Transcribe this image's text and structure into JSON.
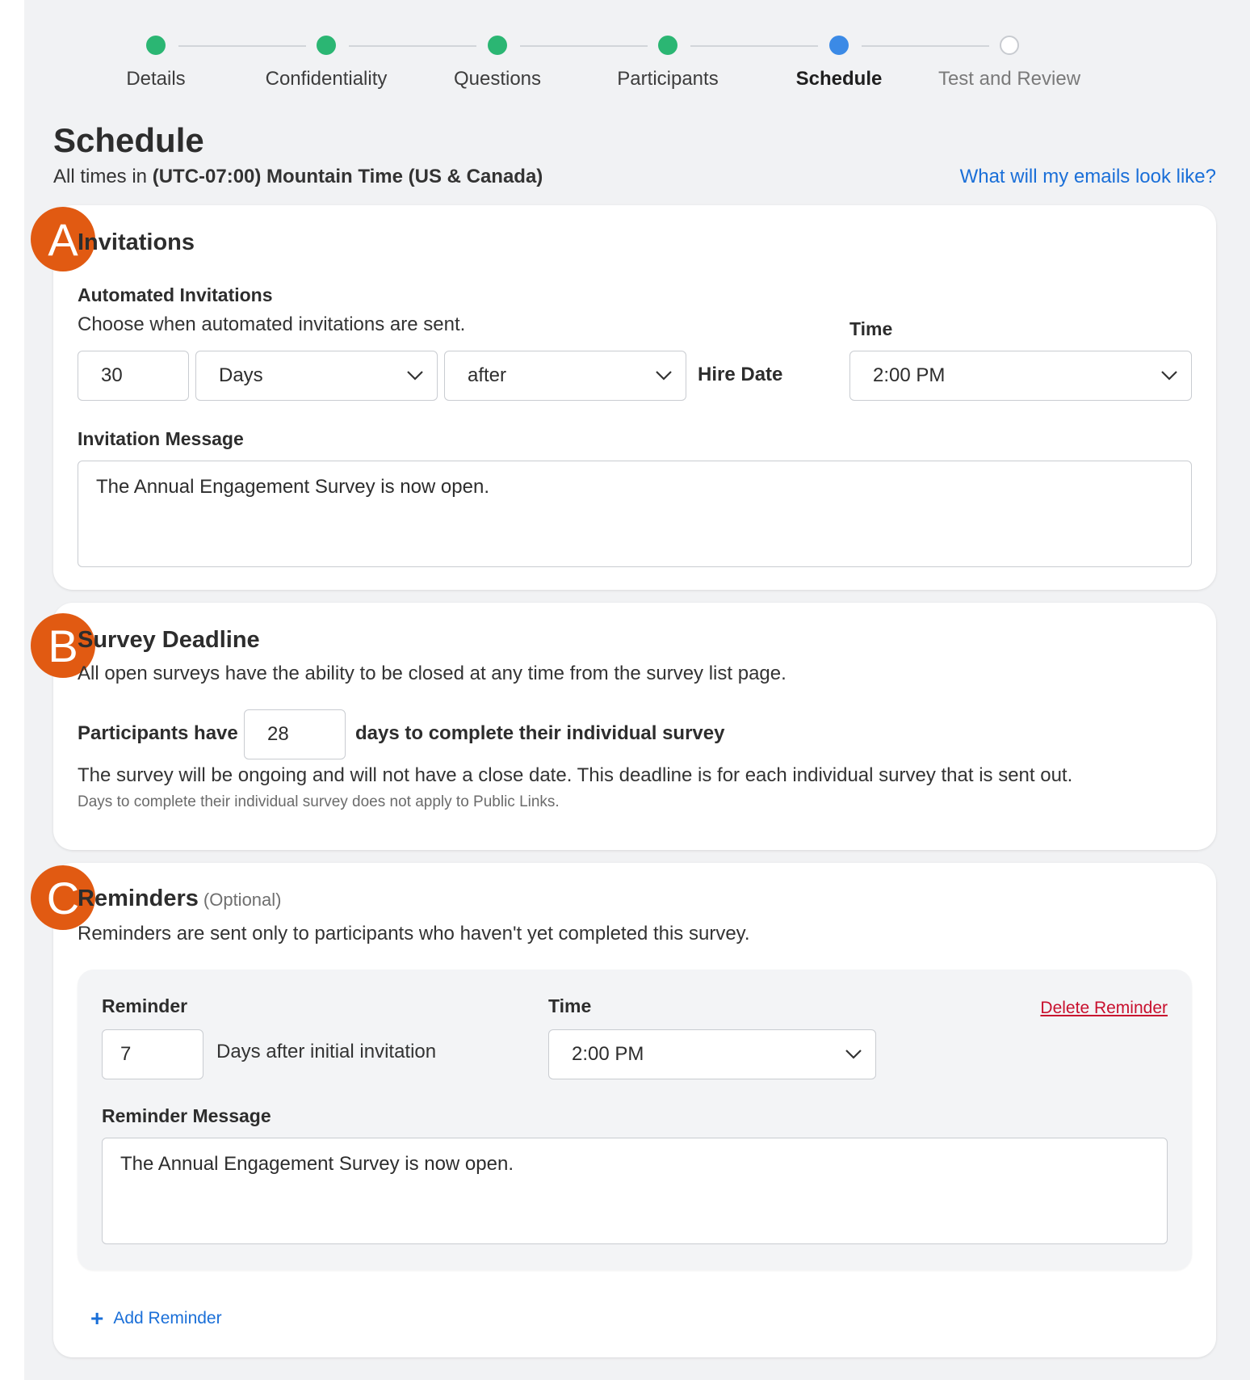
{
  "stepper": {
    "steps": [
      {
        "label": "Details",
        "state": "done"
      },
      {
        "label": "Confidentiality",
        "state": "done"
      },
      {
        "label": "Questions",
        "state": "done"
      },
      {
        "label": "Participants",
        "state": "done"
      },
      {
        "label": "Schedule",
        "state": "current"
      },
      {
        "label": "Test and Review",
        "state": "todo"
      }
    ]
  },
  "header": {
    "title": "Schedule",
    "tz_prefix": "All times in ",
    "tz_value": "(UTC-07:00) Mountain Time (US & Canada)",
    "emails_link": "What will my emails look like?"
  },
  "invitations": {
    "badge": "A",
    "title": "Invitations",
    "automated_label": "Automated Invitations",
    "automated_desc": "Choose when automated invitations are sent.",
    "offset_value": "30",
    "unit_value": "Days",
    "relation_value": "after",
    "anchor_label": "Hire Date",
    "time_label": "Time",
    "time_value": "2:00 PM",
    "message_label": "Invitation Message",
    "message_value": "The Annual Engagement Survey is now open."
  },
  "deadline": {
    "badge": "B",
    "title": "Survey Deadline",
    "desc": "All open surveys have the ability to be closed at any time from the survey list page.",
    "participants_have": "Participants have",
    "days_value": "28",
    "days_suffix": "days to complete their individual survey",
    "ongoing_note": "The survey will be ongoing and will not have a close date. This deadline is for each individual survey that is sent out.",
    "public_links_note": "Days to complete their individual survey does not apply to Public Links."
  },
  "reminders": {
    "badge": "C",
    "title": "Reminders",
    "optional": "(Optional)",
    "desc": "Reminders are sent only to participants who haven't yet completed this survey.",
    "reminder_label": "Reminder",
    "days_value": "7",
    "days_suffix": "Days after initial invitation",
    "time_label": "Time",
    "time_value": "2:00 PM",
    "delete_label": "Delete Reminder",
    "message_label": "Reminder Message",
    "message_value": "The Annual Engagement Survey is now open.",
    "add_label": "Add Reminder"
  },
  "colors": {
    "step_done": "#2bb673",
    "step_current": "#3b8ae6",
    "badge": "#e15a12",
    "link": "#1a6fd8",
    "danger": "#c8102e"
  }
}
